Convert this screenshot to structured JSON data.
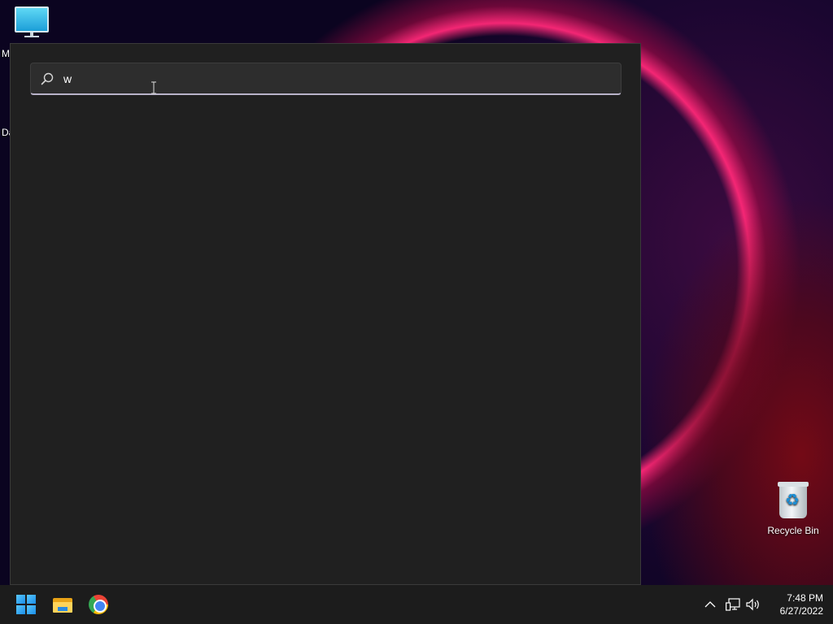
{
  "desktop": {
    "icons": [
      {
        "label_partial_1": "M",
        "label_partial_2": "Da"
      }
    ],
    "recycle_bin": {
      "label": "Recycle Bin"
    }
  },
  "search": {
    "query": "w",
    "placeholder": ""
  },
  "taskbar": {
    "apps": [
      {
        "name": "start",
        "icon": "windows-logo-icon"
      },
      {
        "name": "file-explorer",
        "icon": "folder-icon"
      },
      {
        "name": "chrome",
        "icon": "chrome-icon"
      }
    ],
    "tray": {
      "icons": [
        "chevron-up-icon",
        "network-icon",
        "volume-icon"
      ],
      "time": "7:48 PM",
      "date": "6/27/2022"
    }
  },
  "colors": {
    "panel_bg": "#202020",
    "taskbar_bg": "#1c1c1c",
    "accent": "#1a8ee8"
  }
}
